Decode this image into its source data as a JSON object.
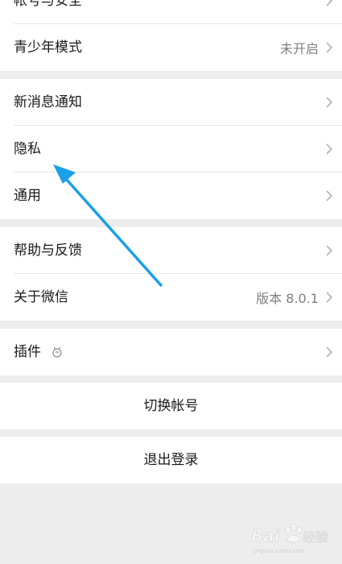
{
  "settings": {
    "account_security": "帐号与安全",
    "teen_mode": {
      "label": "青少年模式",
      "value": "未开启"
    },
    "new_message_notify": "新消息通知",
    "privacy": "隐私",
    "general": "通用",
    "help_feedback": "帮助与反馈",
    "about": {
      "label": "关于微信",
      "value": "版本 8.0.1"
    },
    "plugins": "插件",
    "switch_account": "切换帐号",
    "logout": "退出登录"
  },
  "colors": {
    "background": "#ededed",
    "row": "#ffffff",
    "secondary_text": "#808080",
    "annotation_arrow": "#1aa0e6"
  },
  "icons": {
    "chevron": "chevron-right-icon",
    "plugin": "plugin-face-icon"
  },
  "watermark": "Baidu经验"
}
